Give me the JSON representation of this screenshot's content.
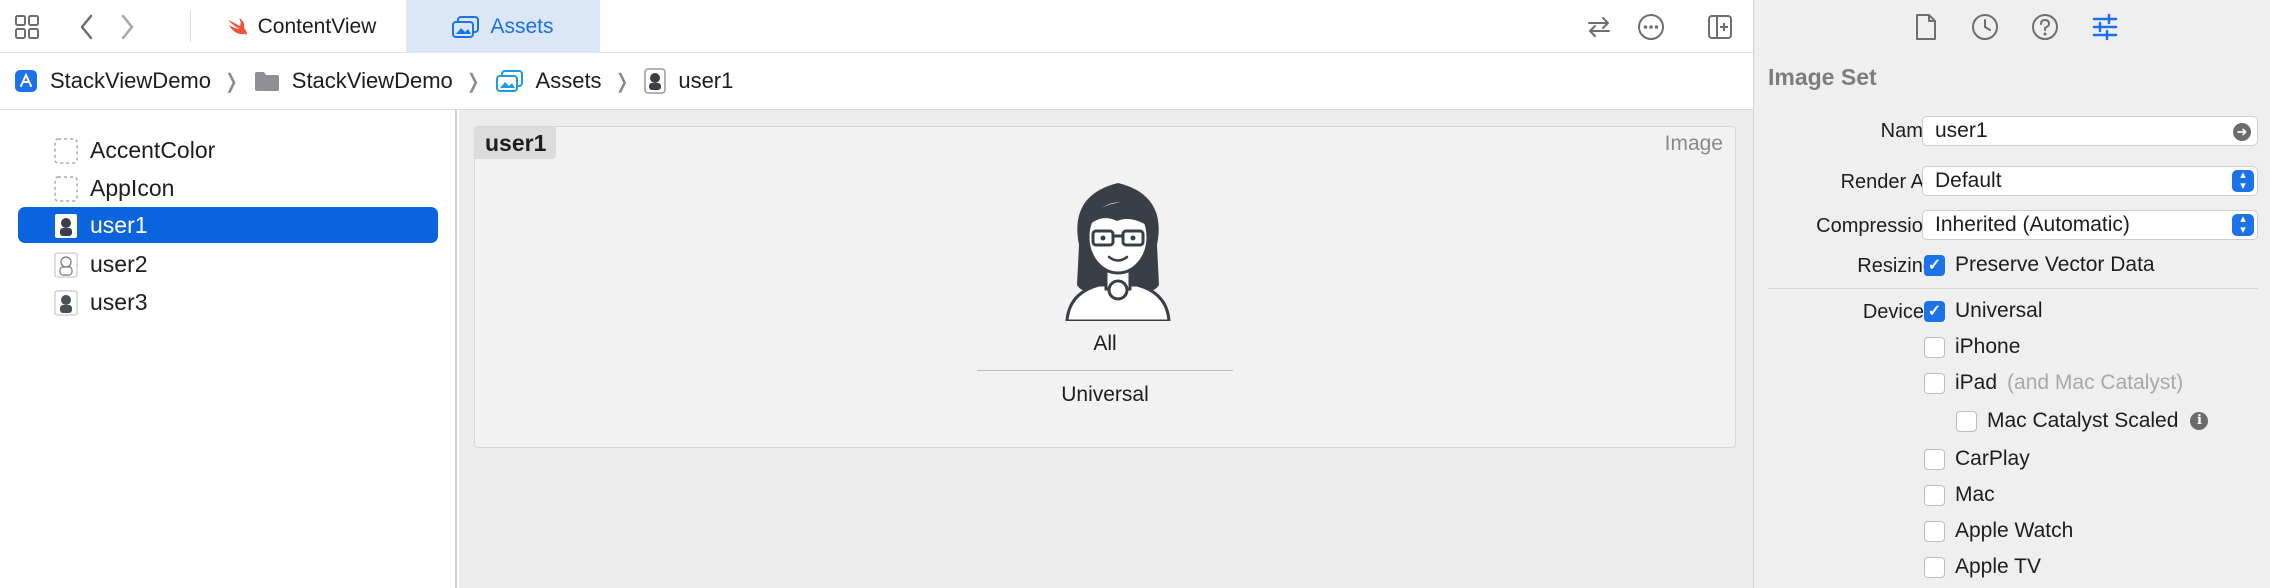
{
  "toolbar": {
    "tabs": [
      {
        "label": "ContentView"
      },
      {
        "label": "Assets"
      }
    ]
  },
  "breadcrumb": [
    {
      "label": "StackViewDemo"
    },
    {
      "label": "StackViewDemo"
    },
    {
      "label": "Assets"
    },
    {
      "label": "user1"
    }
  ],
  "navigator": {
    "items": [
      {
        "label": "AccentColor"
      },
      {
        "label": "AppIcon"
      },
      {
        "label": "user1"
      },
      {
        "label": "user2"
      },
      {
        "label": "user3"
      }
    ]
  },
  "editor": {
    "title": "user1",
    "kind": "Image",
    "slot_label": "All",
    "slot_sublabel": "Universal"
  },
  "inspector": {
    "heading": "Image Set",
    "name_label": "Name",
    "name_value": "user1",
    "render_as_label": "Render As",
    "render_as_value": "Default",
    "compression_label": "Compression",
    "compression_value": "Inherited (Automatic)",
    "resizing_label": "Resizing",
    "resizing_option": "Preserve Vector Data",
    "devices_label": "Devices",
    "devices": [
      {
        "label": "Universal",
        "checked": true
      },
      {
        "label": "iPhone",
        "checked": false
      },
      {
        "label": "iPad",
        "note": "(and Mac Catalyst)",
        "checked": false
      },
      {
        "label": "Mac Catalyst Scaled",
        "checked": false
      },
      {
        "label": "CarPlay",
        "checked": false
      },
      {
        "label": "Mac",
        "checked": false
      },
      {
        "label": "Apple Watch",
        "checked": false
      },
      {
        "label": "Apple TV",
        "checked": false
      }
    ]
  },
  "colors": {
    "accent": "#1a73e8",
    "selection": "#0a64e0",
    "active_tab_bg": "#dbe7f6"
  }
}
